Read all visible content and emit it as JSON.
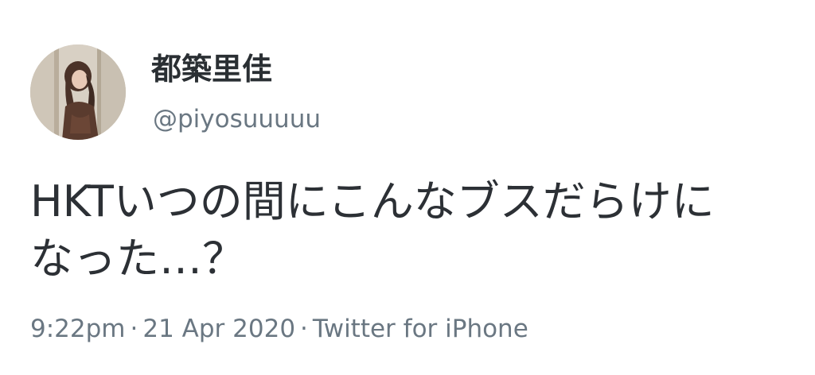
{
  "user": {
    "display_name": "都築里佳",
    "handle": "@piyosuuuuu",
    "avatar_icon": "profile-photo"
  },
  "tweet": {
    "text_line1": "HKTいつの間にこんなブスだらけに",
    "text_line2": "なった…？"
  },
  "meta": {
    "time": "9:22pm",
    "separator": "·",
    "date": "21 Apr 2020",
    "source": "Twitter for iPhone"
  },
  "colors": {
    "name": "#2a2f33",
    "secondary": "#6a7782",
    "text": "#2c3035"
  }
}
